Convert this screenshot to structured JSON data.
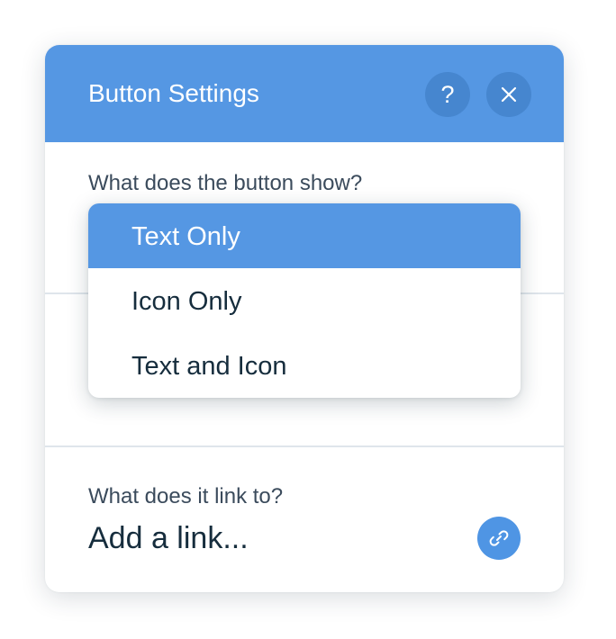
{
  "panel": {
    "title": "Button Settings",
    "help_icon": "question-mark-icon",
    "close_icon": "close-icon",
    "header_color": "#5597e3"
  },
  "show_section": {
    "label": "What does the button show?",
    "options": [
      {
        "label": "Text Only",
        "selected": true
      },
      {
        "label": "Icon Only",
        "selected": false
      },
      {
        "label": "Text and Icon",
        "selected": false
      }
    ]
  },
  "link_section": {
    "label": "What does it link to?",
    "value": "Add a link...",
    "icon": "link-icon"
  }
}
